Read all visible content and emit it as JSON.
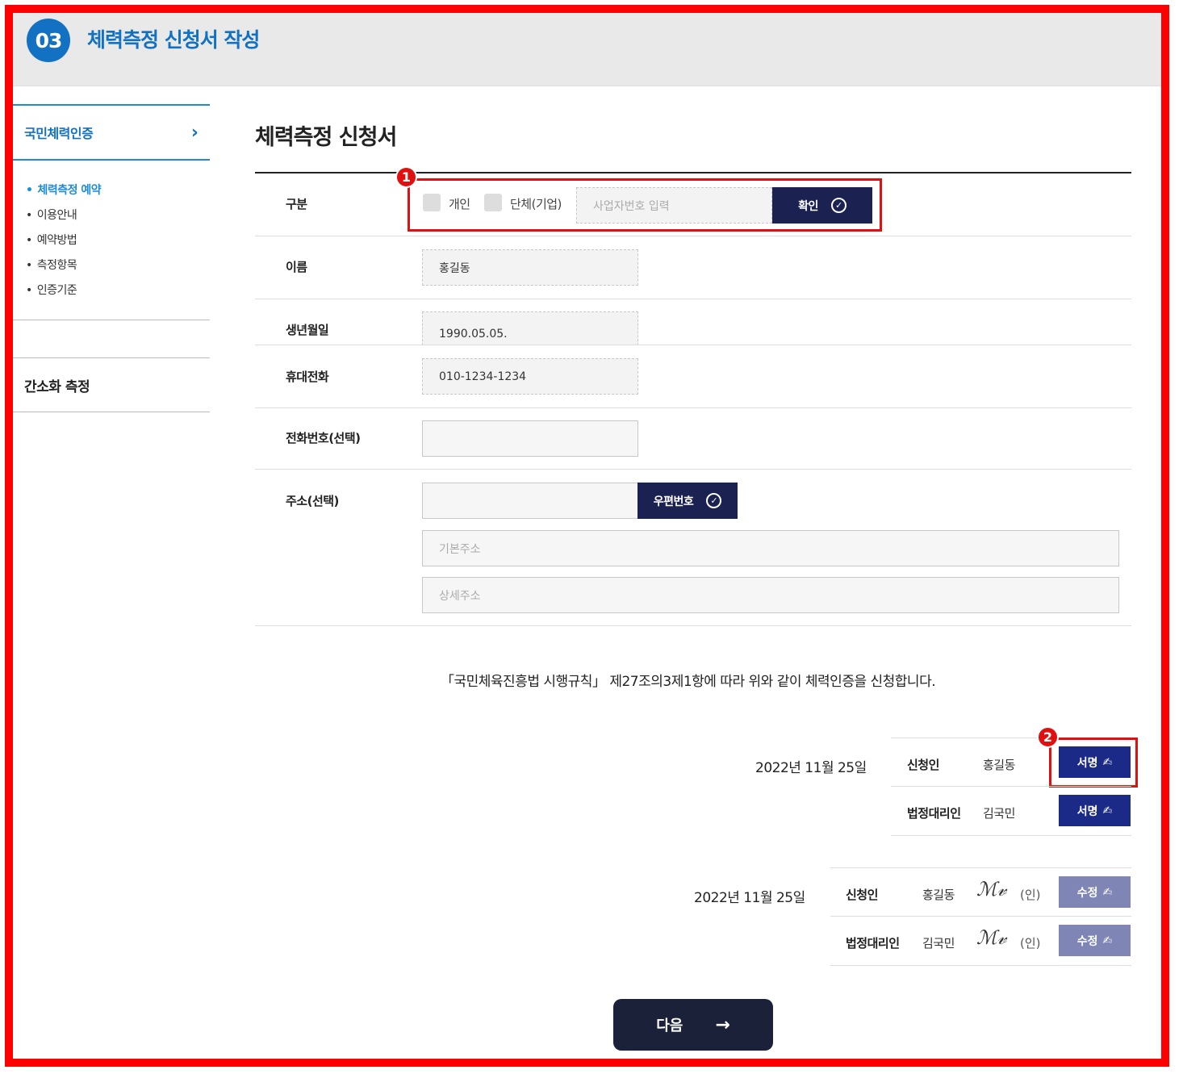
{
  "step": {
    "number": "03",
    "title": "체력측정 신청서 작성"
  },
  "sidebar": {
    "section1": "국민체력인증",
    "items": [
      {
        "label": "체력측정 예약",
        "active": true
      },
      {
        "label": "이용안내",
        "active": false
      },
      {
        "label": "예약방법",
        "active": false
      },
      {
        "label": "측정항목",
        "active": false
      },
      {
        "label": "인증기준",
        "active": false
      }
    ],
    "section2": "간소화 측정"
  },
  "form": {
    "title": "체력측정 신청서",
    "category": {
      "label": "구분",
      "option_individual": "개인",
      "option_group": "단체(기업)",
      "biz_placeholder": "사업자번호 입력",
      "confirm_label": "확인"
    },
    "name": {
      "label": "이름",
      "value": "홍길동"
    },
    "birth": {
      "label": "생년월일",
      "value": "1990.05.05."
    },
    "mobile": {
      "label": "휴대전화",
      "value": "010-1234-1234"
    },
    "phone": {
      "label": "전화번호(선택)",
      "value": ""
    },
    "address": {
      "label": "주소(선택)",
      "zip_value": "",
      "zip_button": "우편번호",
      "base_placeholder": "기본주소",
      "detail_placeholder": "상세주소"
    },
    "statement": "「국민체육진흥법 시행규칙」 제27조의3제1항에 따라 위와 같이 체력인증을 신청합니다."
  },
  "signatures": {
    "unsigned": {
      "date": "2022년 11월 25일",
      "applicant_label": "신청인",
      "applicant_name": "홍길동",
      "guardian_label": "법정대리인",
      "guardian_name": "김국민",
      "sign_button": "서명"
    },
    "signed": {
      "date": "2022년 11월 25일",
      "applicant_label": "신청인",
      "applicant_name": "홍길동",
      "guardian_label": "법정대리인",
      "guardian_name": "김국민",
      "seal": "(인)",
      "edit_button": "수정"
    }
  },
  "annotations": {
    "badge1": "1",
    "badge2": "2"
  },
  "next_button": "다음",
  "colors": {
    "frame": "#ff0000",
    "accent": "#1271c3",
    "dark_button": "#1b2150",
    "sign_button": "#1b2a86",
    "disabled_button": "#7f86b5"
  }
}
